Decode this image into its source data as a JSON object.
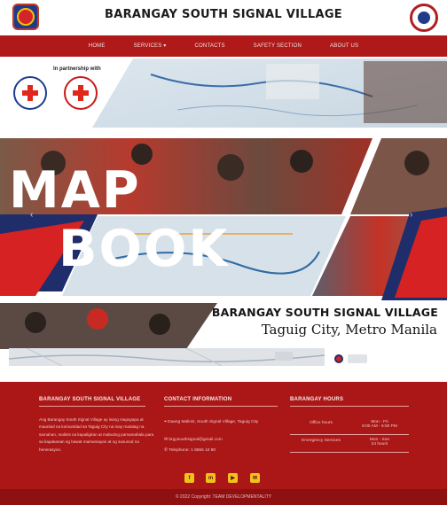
{
  "header": {
    "title": "BARANGAY SOUTH SIGNAL VILLAGE"
  },
  "nav": {
    "items": [
      "HOME",
      "SERVICES ▾",
      "CONTACTS",
      "SAFETY SECTION",
      "ABOUT US"
    ]
  },
  "hero": {
    "partner_text": "In partnership with",
    "word_1": "MAP",
    "word_2": "BOOK",
    "barangay_name": "BARANGAY SOUTH SIGNAL VILLAGE",
    "city": "Taguig City, Metro Manila",
    "colors": {
      "red": "#d62222",
      "navy": "#1f2d6b"
    }
  },
  "footer": {
    "about": {
      "heading": "BARANGAY SOUTH SIGNAL VILLAGE",
      "text": "Ang Barangay South Signal Village ay isang mapayapa at maunlad na komunidad sa Taguig City na may matatag na samahan, malinis na kapaligiran at mabuting pamamahala para sa kapakanan ng bawat mamamayan at ng susunod na henerasyon."
    },
    "contact": {
      "heading": "CONTACT INFORMATION",
      "address": "Daang Malinis, South Signal Village, Taguig City",
      "email": "brgysouthsignal@gmail.com",
      "phone": "Telephone: 1 8555 10 80"
    },
    "hours": {
      "heading": "BARANGAY HOURS",
      "rows": [
        {
          "label": "Office hours",
          "value": "Mon - Fri\n8:00 AM - 5:00 PM"
        },
        {
          "label": "Emergency Services",
          "value": "Mon - Sun\n24 hours"
        }
      ]
    },
    "social_icons": [
      "facebook-icon",
      "messenger-icon",
      "youtube-icon",
      "email-icon"
    ],
    "copyright": "© 2022 Copyright: TEAM DEVELOPMENTALITY"
  }
}
